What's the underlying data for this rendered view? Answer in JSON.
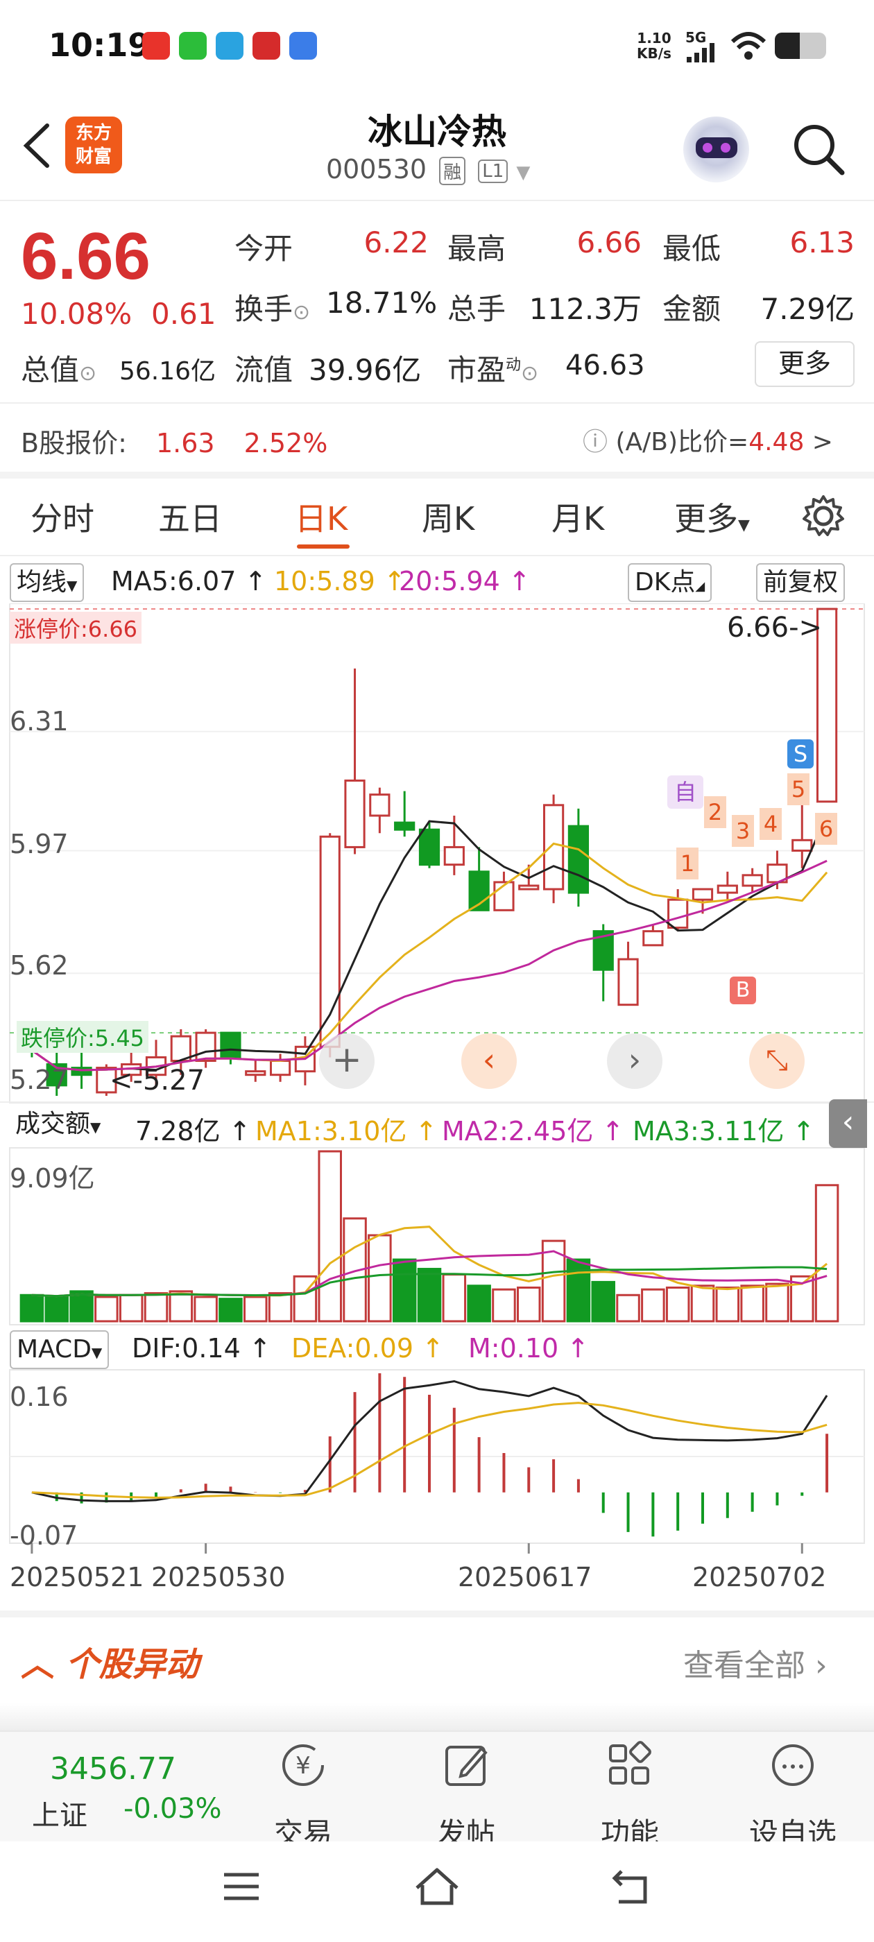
{
  "status_bar": {
    "time": "10:19",
    "net_speed_top": "1.10",
    "net_speed_bottom": "KB/s",
    "signal": "5G"
  },
  "header": {
    "logo_text_1": "东方",
    "logo_text_2": "财富",
    "stock_name": "冰山冷热",
    "stock_code": "000530",
    "tag_rong": "融",
    "tag_level": "L1"
  },
  "quote": {
    "price": "6.66",
    "change_pct": "10.08%",
    "change": "0.61",
    "open_label": "今开",
    "open": "6.22",
    "high_label": "最高",
    "high": "6.66",
    "low_label": "最低",
    "low": "6.13",
    "turnover_label": "换手",
    "turnover": "18.71%",
    "volume_label": "总手",
    "volume": "112.3万",
    "amount_label": "金额",
    "amount": "7.29亿",
    "mktcap_label": "总值",
    "mktcap": "56.16亿",
    "float_label": "流值",
    "float_cap": "39.96亿",
    "pe_label": "市盈",
    "pe_sup": "动",
    "pe": "46.63",
    "more_button": "更多"
  },
  "bshare": {
    "label": "B股报价:",
    "price": "1.63",
    "pct": "2.52%",
    "ratio_label": "(A/B)比价=",
    "ratio": "4.48",
    "arrow": ">"
  },
  "tabs": [
    "分时",
    "五日",
    "日K",
    "周K",
    "月K",
    "更多"
  ],
  "ma_row": {
    "selector": "均线",
    "ma5": "MA5:6.07 ↑",
    "ma10": "10:5.89 ↑",
    "ma20": "20:5.94 ↑",
    "dk": "DK点",
    "adjust": "前复权"
  },
  "kchart_labels": {
    "limit_up": "涨停价:6.66",
    "limit_down": "跌停价:5.45",
    "y1": "6.66",
    "y2": "6.31",
    "y3": "5.97",
    "y4": "5.62",
    "y5": "5.27",
    "max_mark": "6.66->",
    "min_mark": "<-5.27",
    "marker_self": "自",
    "marker_s": "S",
    "marker_b": "B",
    "markers_nums": [
      "1",
      "2",
      "3",
      "4",
      "5",
      "6"
    ]
  },
  "vol_row": {
    "selector": "成交额",
    "value": "7.28亿 ↑",
    "ma1": "MA1:3.10亿 ↑",
    "ma2": "MA2:2.45亿 ↑",
    "ma3": "MA3:3.11亿 ↑",
    "ymax": "9.09亿"
  },
  "macd_row": {
    "selector": "MACD",
    "dif": "DIF:0.14 ↑",
    "dea": "DEA:0.09 ↑",
    "m": "M:0.10 ↑",
    "ytop": "0.16",
    "ybottom": "-0.07"
  },
  "dates": [
    "20250521",
    "20250530",
    "20250617",
    "20250702"
  ],
  "alert": {
    "title": "个股异动",
    "view_all": "查看全部"
  },
  "bottom_nav": {
    "index_value": "3456.77",
    "index_name": "上证",
    "index_change": "-0.03%",
    "trade": "交易",
    "post": "发帖",
    "function": "功能",
    "watchlist": "设自选"
  },
  "chart_data": {
    "type": "candlestick",
    "title": "",
    "ylim": [
      5.27,
      6.66
    ],
    "candles": [
      {
        "o": 5.42,
        "h": 5.47,
        "l": 5.38,
        "c": 5.4
      },
      {
        "o": 5.36,
        "h": 5.42,
        "l": 5.27,
        "c": 5.3
      },
      {
        "o": 5.35,
        "h": 5.44,
        "l": 5.29,
        "c": 5.33
      },
      {
        "o": 5.28,
        "h": 5.36,
        "l": 5.27,
        "c": 5.35
      },
      {
        "o": 5.33,
        "h": 5.4,
        "l": 5.31,
        "c": 5.36
      },
      {
        "o": 5.33,
        "h": 5.43,
        "l": 5.3,
        "c": 5.38
      },
      {
        "o": 5.37,
        "h": 5.46,
        "l": 5.33,
        "c": 5.44
      },
      {
        "o": 5.37,
        "h": 5.46,
        "l": 5.35,
        "c": 5.45
      },
      {
        "o": 5.45,
        "h": 5.45,
        "l": 5.36,
        "c": 5.38
      },
      {
        "o": 5.33,
        "h": 5.37,
        "l": 5.31,
        "c": 5.34
      },
      {
        "o": 5.33,
        "h": 5.39,
        "l": 5.31,
        "c": 5.37
      },
      {
        "o": 5.34,
        "h": 5.44,
        "l": 5.3,
        "c": 5.41
      },
      {
        "o": 5.41,
        "h": 6.02,
        "l": 5.38,
        "c": 6.01
      },
      {
        "o": 5.98,
        "h": 6.49,
        "l": 5.96,
        "c": 6.17
      },
      {
        "o": 6.07,
        "h": 6.15,
        "l": 6.02,
        "c": 6.13
      },
      {
        "o": 6.05,
        "h": 6.14,
        "l": 6.01,
        "c": 6.03
      },
      {
        "o": 6.03,
        "h": 6.05,
        "l": 5.92,
        "c": 5.93
      },
      {
        "o": 5.93,
        "h": 6.07,
        "l": 5.9,
        "c": 5.98
      },
      {
        "o": 5.91,
        "h": 5.98,
        "l": 5.86,
        "c": 5.8
      },
      {
        "o": 5.8,
        "h": 5.91,
        "l": 5.8,
        "c": 5.88
      },
      {
        "o": 5.86,
        "h": 5.93,
        "l": 5.86,
        "c": 5.87
      },
      {
        "o": 5.86,
        "h": 6.13,
        "l": 5.82,
        "c": 6.1
      },
      {
        "o": 6.04,
        "h": 6.09,
        "l": 5.81,
        "c": 5.85
      },
      {
        "o": 5.74,
        "h": 5.76,
        "l": 5.54,
        "c": 5.63
      },
      {
        "o": 5.53,
        "h": 5.71,
        "l": 5.53,
        "c": 5.66
      },
      {
        "o": 5.7,
        "h": 5.76,
        "l": 5.7,
        "c": 5.74
      },
      {
        "o": 5.75,
        "h": 5.86,
        "l": 5.74,
        "c": 5.83
      },
      {
        "o": 5.83,
        "h": 5.86,
        "l": 5.79,
        "c": 5.86
      },
      {
        "o": 5.85,
        "h": 5.91,
        "l": 5.83,
        "c": 5.87
      },
      {
        "o": 5.87,
        "h": 5.92,
        "l": 5.85,
        "c": 5.9
      },
      {
        "o": 5.88,
        "h": 5.97,
        "l": 5.86,
        "c": 5.93
      },
      {
        "o": 5.97,
        "h": 6.11,
        "l": 5.92,
        "c": 6.0
      },
      {
        "o": 6.11,
        "h": 6.66,
        "l": 6.13,
        "c": 6.66
      }
    ],
    "amount_yi": [
      1.4,
      1.3,
      1.6,
      1.3,
      1.4,
      1.5,
      1.6,
      1.3,
      1.2,
      1.3,
      1.5,
      2.4,
      9.09,
      5.5,
      4.6,
      3.3,
      2.8,
      2.5,
      1.9,
      1.7,
      1.8,
      4.3,
      3.3,
      2.1,
      1.4,
      1.7,
      1.8,
      1.9,
      1.8,
      1.9,
      2.0,
      2.4,
      7.28
    ],
    "macd": {
      "dif_range": [
        -0.07,
        0.16
      ]
    }
  }
}
